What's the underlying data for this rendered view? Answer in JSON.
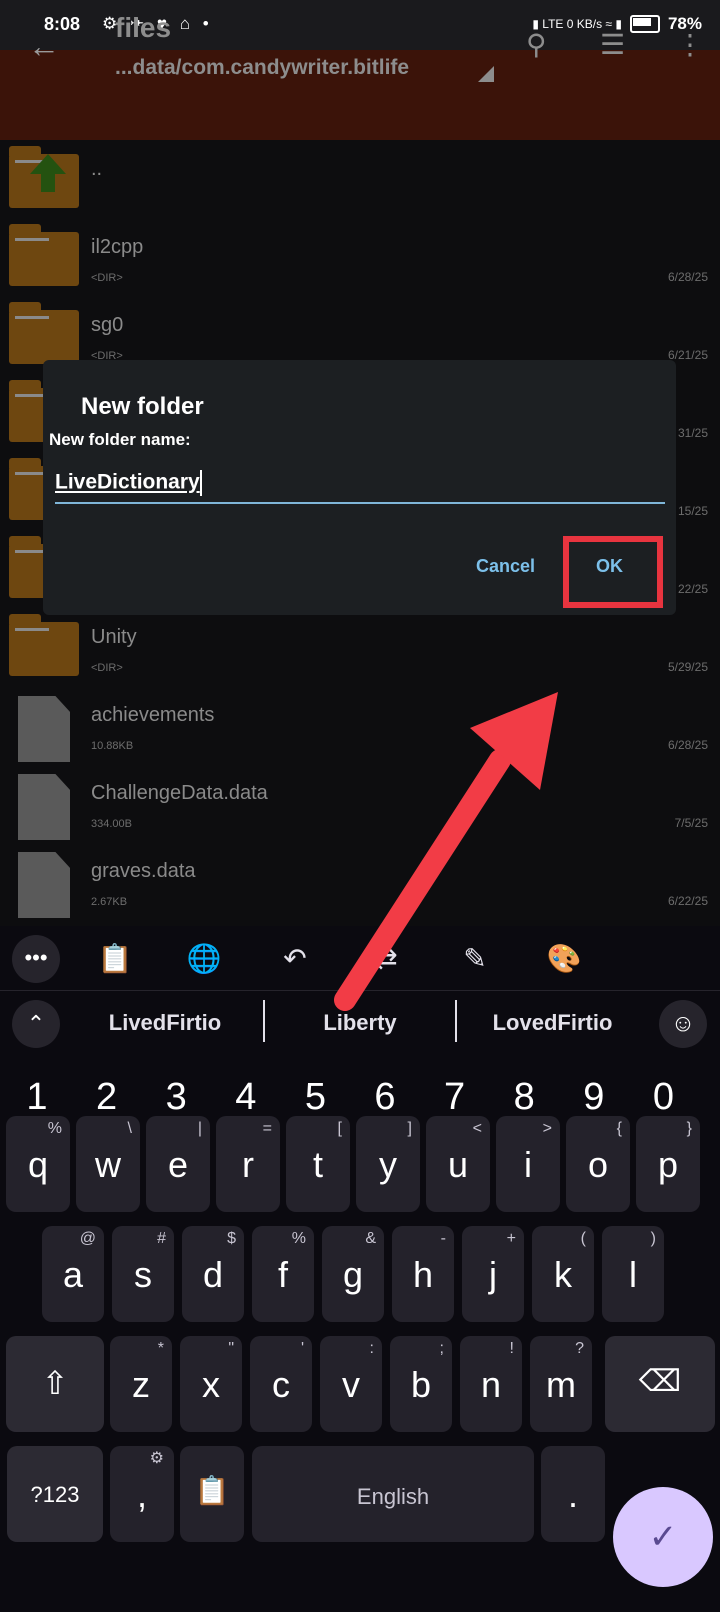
{
  "status_bar": {
    "time": "8:08",
    "left_icons": "⚙ ✈ ♥ ⌂ •",
    "right_icons": "▮ LTE 0 KB/s ≈ ▮",
    "battery": "78%"
  },
  "app_bar": {
    "title": "files",
    "path": "...data/com.candywriter.bitlife"
  },
  "files": [
    {
      "name": "..",
      "meta": "",
      "date": "",
      "type": "up"
    },
    {
      "name": "il2cpp",
      "meta": "<DIR>",
      "date": "6/28/25",
      "type": "folder"
    },
    {
      "name": "sg0",
      "meta": "<DIR>",
      "date": "6/21/25",
      "type": "folder"
    },
    {
      "name": "",
      "meta": "",
      "date": "31/25",
      "type": "folder"
    },
    {
      "name": "",
      "meta": "",
      "date": "15/25",
      "type": "folder"
    },
    {
      "name": "",
      "meta": "",
      "date": "22/25",
      "type": "folder"
    },
    {
      "name": "Unity",
      "meta": "<DIR>",
      "date": "5/29/25",
      "type": "folder"
    },
    {
      "name": "achievements",
      "meta": "10.88KB",
      "date": "6/28/25",
      "type": "doc"
    },
    {
      "name": "ChallengeData.data",
      "meta": "334.00B",
      "date": "7/5/25",
      "type": "doc"
    },
    {
      "name": "graves.data",
      "meta": "2.67KB",
      "date": "6/22/25",
      "type": "doc"
    }
  ],
  "dialog": {
    "title": "New folder",
    "label": "New folder name:",
    "input_value": "LiveDictionary",
    "cancel": "Cancel",
    "ok": "OK"
  },
  "keyboard": {
    "suggestions": [
      "LivedFirtio",
      "Liberty",
      "LovedFirtio"
    ],
    "numbers": [
      "1",
      "2",
      "3",
      "4",
      "5",
      "6",
      "7",
      "8",
      "9",
      "0"
    ],
    "row1": [
      [
        "q",
        "%"
      ],
      [
        "w",
        "\\"
      ],
      [
        "e",
        "|"
      ],
      [
        "r",
        "="
      ],
      [
        "t",
        "["
      ],
      [
        "y",
        "]"
      ],
      [
        "u",
        "<"
      ],
      [
        "i",
        ">"
      ],
      [
        "o",
        "{"
      ],
      [
        "p",
        "}"
      ]
    ],
    "row2": [
      [
        "a",
        "@"
      ],
      [
        "s",
        "#"
      ],
      [
        "d",
        "$"
      ],
      [
        "f",
        "%"
      ],
      [
        "g",
        "&"
      ],
      [
        "h",
        "-"
      ],
      [
        "j",
        "+"
      ],
      [
        "k",
        "("
      ],
      [
        "l",
        ")"
      ]
    ],
    "row3": [
      [
        "z",
        "*"
      ],
      [
        "x",
        "\""
      ],
      [
        "c",
        "'"
      ],
      [
        "v",
        ":"
      ],
      [
        "b",
        ";"
      ],
      [
        "n",
        "!"
      ],
      [
        "m",
        "?"
      ]
    ],
    "sym_key": "?123",
    "comma": ",",
    "space_label": "English",
    "period": "."
  },
  "colors": {
    "accent": "#7cc0ea",
    "highlight": "#e8343f",
    "confirm": "#d9c8ff"
  }
}
